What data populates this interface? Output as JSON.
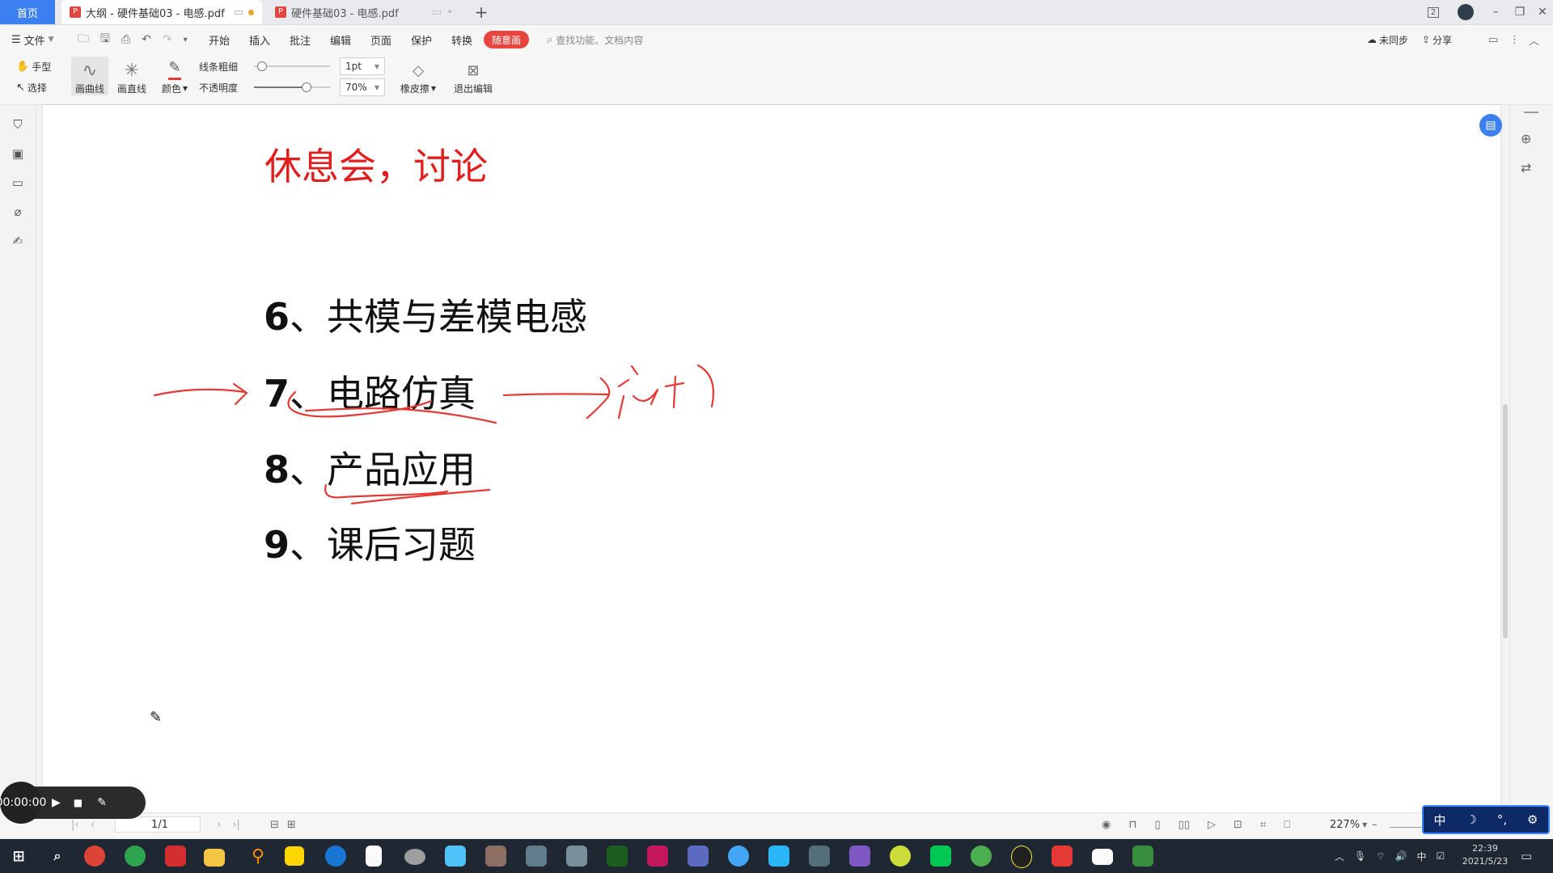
{
  "titlebar": {
    "home_tab": "首页",
    "active_tab": "大纲 - 硬件基础03 - 电感.pdf",
    "inactive_tab": "硬件基础03 - 电感.pdf",
    "new_tab_icon": "+",
    "page_count_badge": "2"
  },
  "menu": {
    "file": "文件",
    "items": [
      "开始",
      "插入",
      "批注",
      "编辑",
      "页面",
      "保护",
      "转换"
    ],
    "active_pill": "随意画",
    "search_placeholder": "查找功能、文档内容",
    "sync": "未同步",
    "share": "分享"
  },
  "toolbar": {
    "hand": "手型",
    "select": "选择",
    "curve": "画曲线",
    "line": "画直线",
    "color": "颜色",
    "line_width_label": "线条粗细",
    "opacity_label": "不透明度",
    "line_width_value": "1pt",
    "opacity_value": "70%",
    "line_width_fraction": 0.05,
    "opacity_fraction": 0.7,
    "eraser": "橡皮擦",
    "exit": "退出编辑",
    "pen_color": "#e53935"
  },
  "document": {
    "heading": "休息会，讨论",
    "items": [
      {
        "num": "6",
        "sep": "、",
        "text": "共模与差模电感"
      },
      {
        "num": "7",
        "sep": "、",
        "text": "电路仿真"
      },
      {
        "num": "8",
        "sep": "、",
        "text": "产品应用"
      },
      {
        "num": "9",
        "sep": "、",
        "text": "课后习题"
      }
    ],
    "heading_color": "#e01e1e",
    "ink_color": "#e53935"
  },
  "statusbar": {
    "page": "1/1",
    "zoom": "227%"
  },
  "recorder": {
    "time": "00:00:00"
  },
  "ime": {
    "mode": "中"
  },
  "taskbar": {
    "tray_ime": "中",
    "time": "22:39",
    "date": "2021/5/23"
  }
}
